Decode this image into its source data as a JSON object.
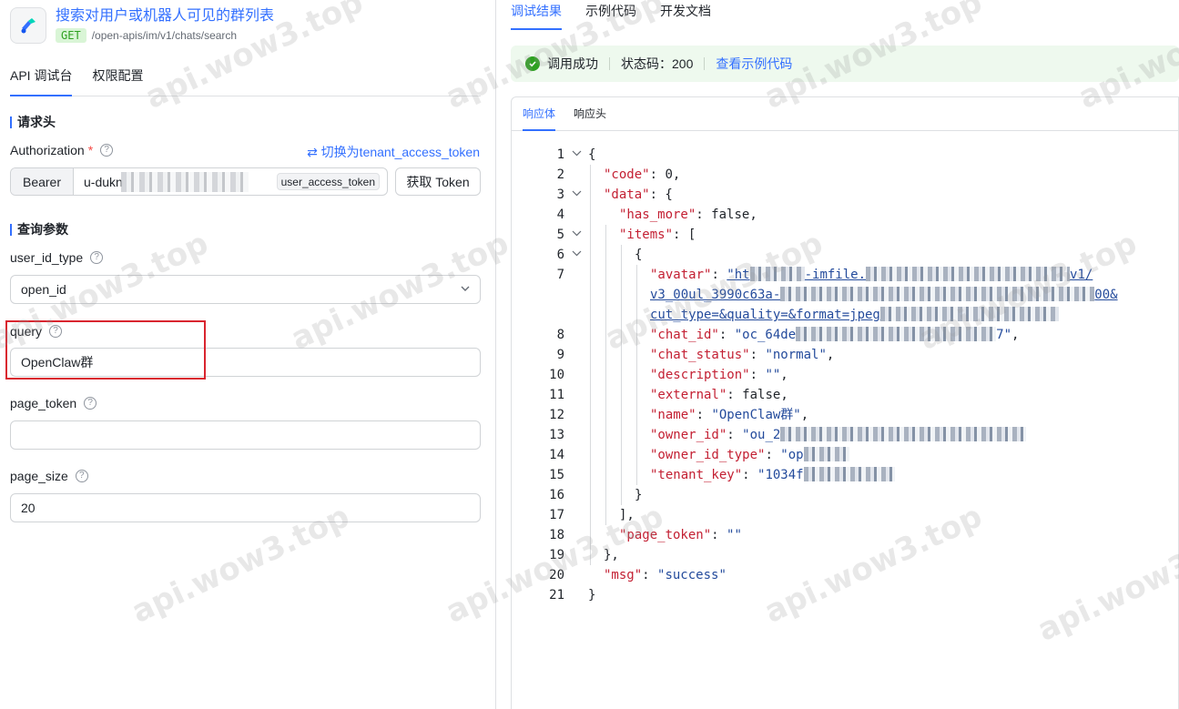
{
  "api": {
    "title": "搜索对用户或机器人可见的群列表",
    "method": "GET",
    "path": "/open-apis/im/v1/chats/search"
  },
  "left_tabs": [
    "API 调试台",
    "权限配置"
  ],
  "request_header": {
    "section_title": "请求头",
    "auth_label": "Authorization",
    "required_mark": "*",
    "switch_text": "⇄ 切换为tenant_access_token",
    "bearer": "Bearer",
    "token_prefix": "u-dukn",
    "token_tag": "user_access_token",
    "get_token_label": "获取 Token"
  },
  "query_params": {
    "section_title": "查询参数",
    "user_id_type_label": "user_id_type",
    "user_id_type_value": "open_id",
    "query_label": "query",
    "query_value": "OpenClaw群",
    "page_token_label": "page_token",
    "page_token_value": "",
    "page_size_label": "page_size",
    "page_size_value": "20"
  },
  "right_tabs": [
    "调试结果",
    "示例代码",
    "开发文档"
  ],
  "status": {
    "result": "调用成功",
    "code_label": "状态码：200",
    "sample_link": "查看示例代码",
    "ok_color": "#2ea121"
  },
  "response_tabs": [
    "响应体",
    "响应头"
  ],
  "code_lines": [
    {
      "n": "1"
    },
    {
      "n": "2"
    },
    {
      "n": "3"
    },
    {
      "n": "4"
    },
    {
      "n": "5"
    },
    {
      "n": "6"
    },
    {
      "n": "7"
    },
    {
      "n": ""
    },
    {
      "n": ""
    },
    {
      "n": "8"
    },
    {
      "n": "9"
    },
    {
      "n": "10"
    },
    {
      "n": "11"
    },
    {
      "n": "12"
    },
    {
      "n": "13"
    },
    {
      "n": "14"
    },
    {
      "n": "15"
    },
    {
      "n": "16"
    },
    {
      "n": "17"
    },
    {
      "n": "18"
    },
    {
      "n": "19"
    },
    {
      "n": "20"
    },
    {
      "n": "21"
    }
  ],
  "json": {
    "code_key": "\"code\"",
    "code_val": "0",
    "data_key": "\"data\"",
    "has_more_key": "\"has_more\"",
    "has_more_val": "false",
    "items_key": "\"items\"",
    "avatar_key": "\"avatar\"",
    "avatar_p1": "\"ht",
    "avatar_p1b": "-imfile.",
    "avatar_p1c": "v1/",
    "avatar_p2": "v3_00ul_3990c63a-",
    "avatar_p2c": "00&",
    "avatar_p3": "cut_type=&quality=&format=jpeg",
    "chat_id_key": "\"chat_id\"",
    "chat_id_val": "\"oc_64de",
    "chat_id_end": "7\"",
    "chat_status_key": "\"chat_status\"",
    "chat_status_val": "\"normal\"",
    "description_key": "\"description\"",
    "description_val": "\"\"",
    "external_key": "\"external\"",
    "external_val": "false",
    "name_key": "\"name\"",
    "name_val": "\"OpenClaw群\"",
    "owner_id_key": "\"owner_id\"",
    "owner_id_val": "\"ou_2",
    "owner_id_type_key": "\"owner_id_type\"",
    "owner_id_type_val": "\"op",
    "tenant_key_key": "\"tenant_key\"",
    "tenant_key_val": "\"1034f",
    "page_token_key": "\"page_token\"",
    "page_token_val": "\"\"",
    "msg_key": "\"msg\"",
    "msg_val": "\"success\""
  },
  "watermark": "api.wow3.top"
}
